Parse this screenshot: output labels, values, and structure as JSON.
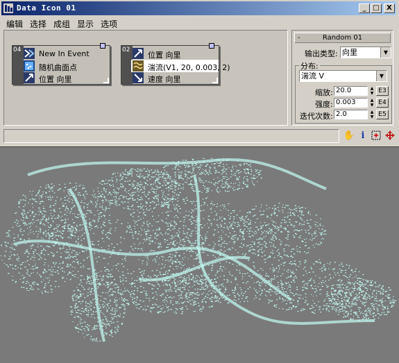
{
  "window": {
    "title": "Data Icon 01",
    "buttons": [
      "_",
      "□",
      "X"
    ]
  },
  "menu": [
    "编辑",
    "选择",
    "成组",
    "显示",
    "选项"
  ],
  "events": [
    {
      "number": "04",
      "operators": [
        {
          "icon": "birth-event-icon",
          "label": "New In Event"
        },
        {
          "icon": "surface-position-icon",
          "label": "随机曲面点"
        },
        {
          "icon": "position-facing-icon",
          "label": "位置 向里"
        }
      ]
    },
    {
      "number": "02",
      "operators": [
        {
          "icon": "position-facing-icon",
          "label": "位置 向里"
        },
        {
          "icon": "turbulence-icon",
          "label": "湍流(V1, 20, 0.003, 2)"
        },
        {
          "icon": "speed-facing-icon",
          "label": "速度 向里"
        }
      ]
    }
  ],
  "panel": {
    "rollout_title": "Random 01",
    "output_type_label": "输出类型:",
    "output_type_value": "向里",
    "distribution_group": "分布:",
    "distribution_value": "湍流 V",
    "scale_label": "缩放:",
    "scale_value": "20.0",
    "scale_key": "E3",
    "strength_label": "强度:",
    "strength_value": "0.003",
    "strength_key": "E4",
    "iterations_label": "迭代次数:",
    "iterations_value": "2.0",
    "iterations_key": "E5"
  },
  "toolbar_icons": [
    "hand-pan-icon",
    "info-icon",
    "region-zoom-icon",
    "move-icon"
  ],
  "colors": {
    "title_bar": "#0a246a",
    "viewport_bg": "#7a7a7a",
    "particles": "#bff5ee",
    "selected_row": "#ffffff"
  }
}
